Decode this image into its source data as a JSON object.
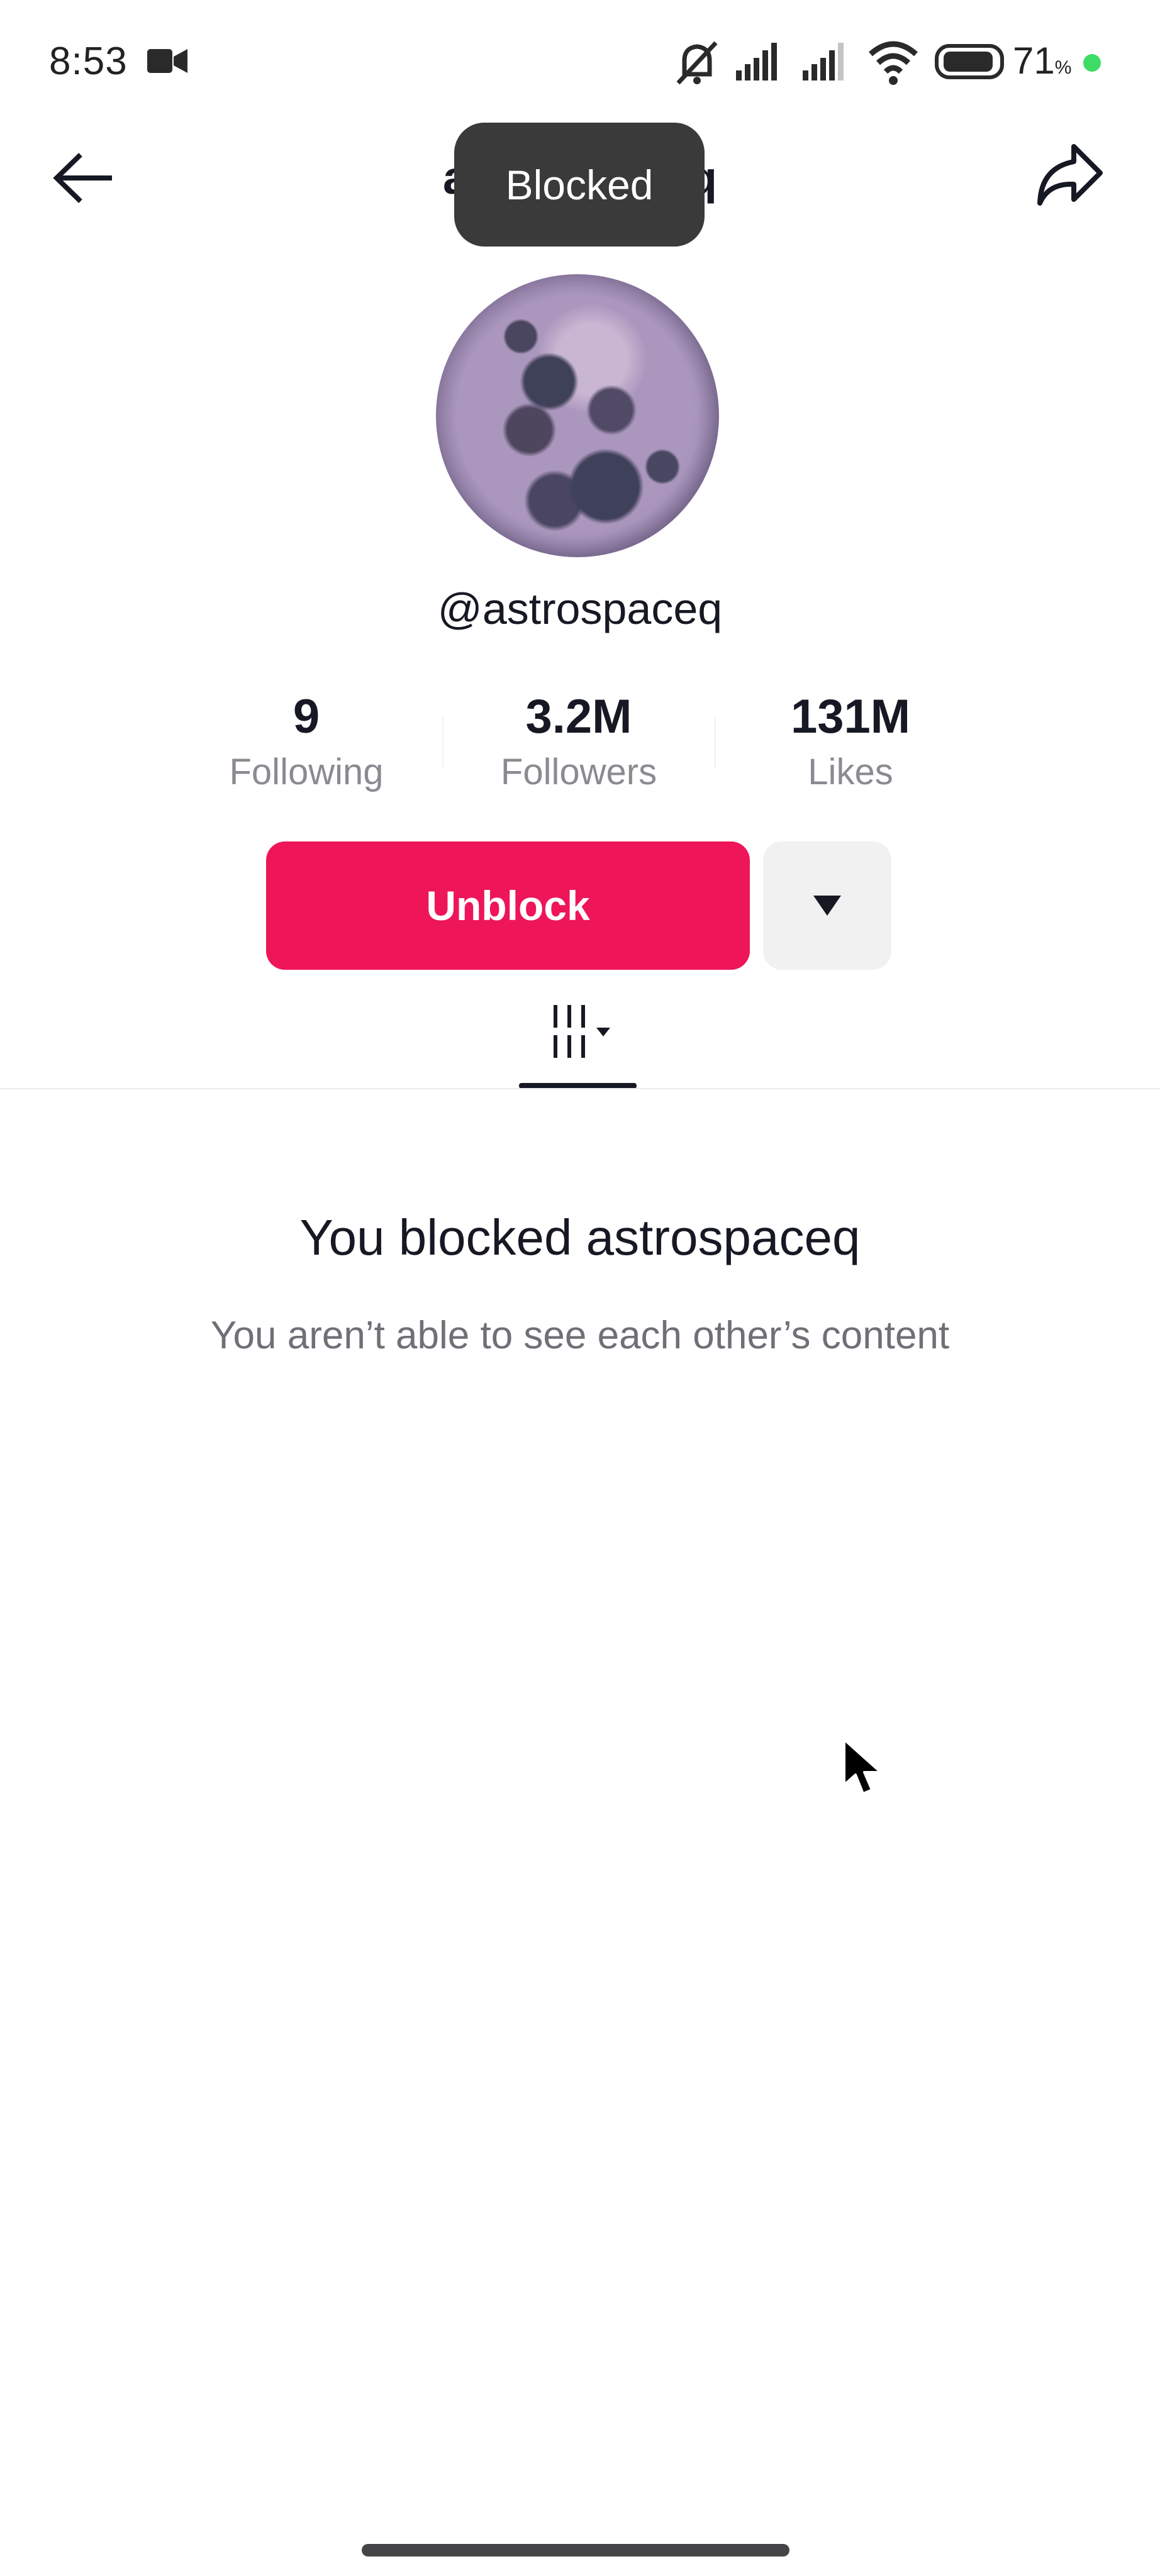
{
  "status_bar": {
    "time": "8:53",
    "icons": [
      "video-camera-icon",
      "mute-icon",
      "signal-1-icon",
      "signal-2-icon",
      "wifi-icon",
      "battery-icon"
    ],
    "battery_level": "71",
    "battery_unit": "%",
    "battery_dot_color": "#3ddc64"
  },
  "header": {
    "title": "astrospaceq",
    "back_icon": "arrow-left-icon",
    "share_icon": "share-icon"
  },
  "toast": {
    "text": "Blocked"
  },
  "profile": {
    "avatar_alt": "moon avatar",
    "username": "@astrospaceq",
    "stats": [
      {
        "value": "9",
        "label": "Following"
      },
      {
        "value": "3.2M",
        "label": "Followers"
      },
      {
        "value": "131M",
        "label": "Likes"
      }
    ]
  },
  "actions": {
    "unblock_label": "Unblock",
    "unblock_color": "#ee1558",
    "more_icon": "triangle-down-icon"
  },
  "tabs": {
    "active": "videos-grid",
    "icon": "grid-icon"
  },
  "blocked_notice": {
    "title": "You blocked astrospaceq",
    "subtitle": "You aren’t able to see each other’s content"
  }
}
